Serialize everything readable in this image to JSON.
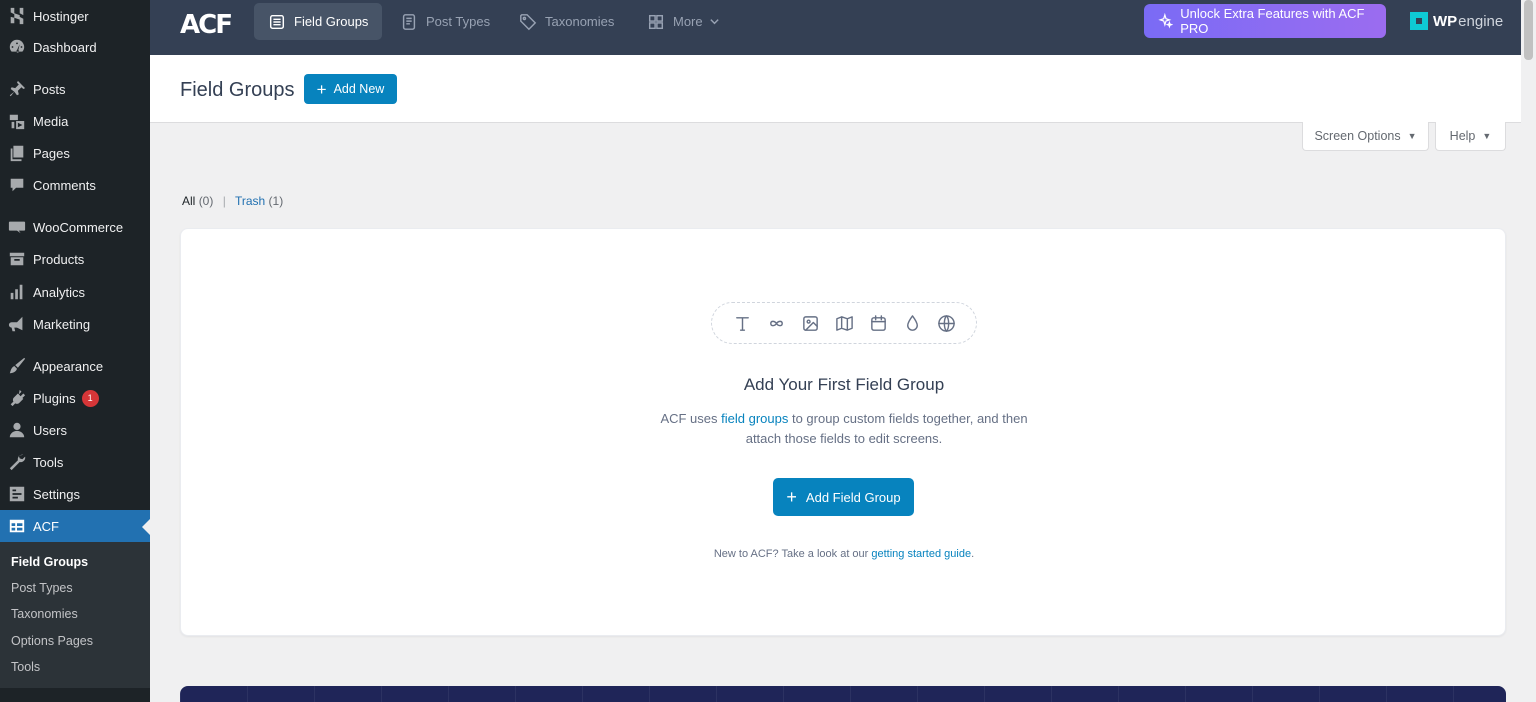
{
  "sidebar": {
    "items": [
      {
        "label": "Hostinger",
        "icon": "hostinger-icon"
      },
      {
        "label": "Dashboard",
        "icon": "dashboard-icon"
      },
      {
        "label": "Posts",
        "icon": "pin-icon"
      },
      {
        "label": "Media",
        "icon": "media-icon"
      },
      {
        "label": "Pages",
        "icon": "pages-icon"
      },
      {
        "label": "Comments",
        "icon": "comment-icon"
      },
      {
        "label": "WooCommerce",
        "icon": "woocommerce-icon"
      },
      {
        "label": "Products",
        "icon": "archive-icon"
      },
      {
        "label": "Analytics",
        "icon": "bar-chart-icon"
      },
      {
        "label": "Marketing",
        "icon": "megaphone-icon"
      },
      {
        "label": "Appearance",
        "icon": "paintbrush-icon"
      },
      {
        "label": "Plugins",
        "icon": "plug-icon",
        "badge": "1"
      },
      {
        "label": "Users",
        "icon": "user-icon"
      },
      {
        "label": "Tools",
        "icon": "wrench-icon"
      },
      {
        "label": "Settings",
        "icon": "settings-icon"
      },
      {
        "label": "ACF",
        "icon": "acf-table-icon",
        "current": true
      }
    ],
    "submenu": [
      "Field Groups",
      "Post Types",
      "Taxonomies",
      "Options Pages",
      "Tools"
    ]
  },
  "acf_header": {
    "logo": "ACF",
    "tabs": [
      {
        "label": "Field Groups",
        "icon": "list-icon",
        "active": true
      },
      {
        "label": "Post Types",
        "icon": "document-icon"
      },
      {
        "label": "Taxonomies",
        "icon": "tag-icon"
      },
      {
        "label": "More",
        "icon": "grid-icon"
      }
    ],
    "pro_button": "Unlock Extra Features with ACF PRO",
    "partner_logo_bold": "WP",
    "partner_logo_light": "engine"
  },
  "page": {
    "title": "Field Groups",
    "add_new": "Add New",
    "screen_options": "Screen Options",
    "help": "Help"
  },
  "filters": {
    "all_label": "All",
    "all_count": "(0)",
    "trash_label": "Trash",
    "trash_count": "(1)"
  },
  "empty_state": {
    "title": "Add Your First Field Group",
    "desc_before": "ACF uses ",
    "desc_link": "field groups",
    "desc_after": " to group custom fields together, and then attach those fields to edit screens.",
    "button": "Add Field Group",
    "guide_before": "New to ACF? Take a look at our ",
    "guide_link": "getting started guide",
    "guide_after": ".",
    "field_icons": [
      "text-icon",
      "infinity-icon",
      "image-icon",
      "map-icon",
      "calendar-icon",
      "droplet-icon",
      "globe-icon"
    ]
  },
  "colors": {
    "sidebar_bg": "#1d2327",
    "acf_header_bg": "#344054",
    "primary_blue": "#0783be",
    "wp_blue": "#2271b1",
    "pro_gradient_start": "#7a6bf5",
    "pro_gradient_end": "#9b6cf0",
    "badge_red": "#d63638"
  }
}
